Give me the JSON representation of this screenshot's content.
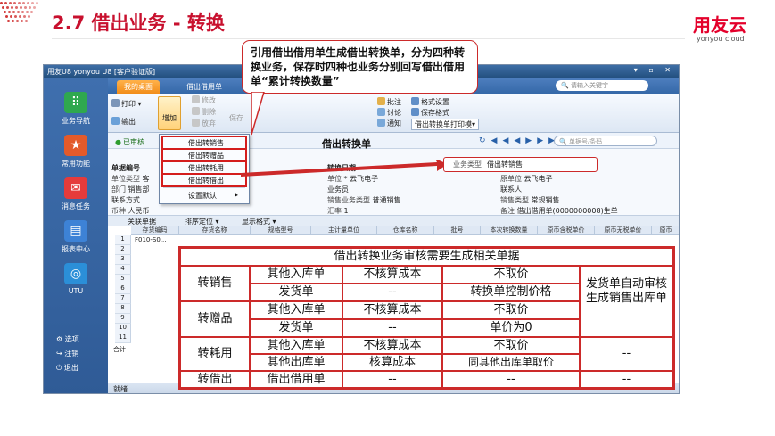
{
  "slide": {
    "title": "2.7 借出业务 - 转换",
    "brand": "用友云",
    "brand_sub": "yonyou cloud"
  },
  "window": {
    "title": "用友U8  yonyou U8 [客户验证版]",
    "controls": "▾ ▫ ✕"
  },
  "sidebar": {
    "items": [
      {
        "label": "业务导航",
        "icon": "nav-icon",
        "color": "#2fa84f"
      },
      {
        "label": "常用功能",
        "icon": "star-icon",
        "color": "#e35a2a"
      },
      {
        "label": "消息任务",
        "icon": "mail-icon",
        "color": "#e53b3b"
      },
      {
        "label": "报表中心",
        "icon": "report-icon",
        "color": "#3d82d6"
      },
      {
        "label": "UTU",
        "icon": "utu-icon",
        "color": "#2b8fd8"
      }
    ],
    "bottom": [
      "选项",
      "注销",
      "退出"
    ]
  },
  "tabs": {
    "items": [
      "我的桌面",
      "借出借用单"
    ],
    "search_placeholder": "请输入关键字"
  },
  "ribbon": {
    "print": "打印",
    "output": "输出",
    "add": "增加",
    "modify": "修改",
    "delete": "删除",
    "discard": "放弃",
    "save": "保存",
    "approve": "批注",
    "discuss": "讨论",
    "notify": "通知",
    "format_settings": "格式设置",
    "save_format": "保存格式",
    "print_template": "借出转换单打印模▾"
  },
  "nav": {
    "status": "已审核",
    "form_title": "借出转换单",
    "search_placeholder": "单据号/条码"
  },
  "form": {
    "doc_no_label": "单据编号",
    "doc_date_label": "转换日期",
    "unit_type_label": "单位类型",
    "unit_type_value": "客",
    "unit_label": "单位",
    "unit_value": "云飞电子",
    "orig_unit_label": "原单位",
    "orig_unit_value": "云飞电子",
    "dept_label": "部门",
    "dept_value": "销售部",
    "salesman_label": "业务员",
    "contact_label": "联系人",
    "contact_method_label": "联系方式",
    "biz_type2_label": "销售业务类型",
    "biz_type2_value": "普通销售",
    "sales_type_label": "销售类型",
    "sales_type_value": "常规销售",
    "currency_label": "币种",
    "currency_value": "人民币",
    "rate_label": "汇率",
    "rate_value": "1",
    "remark_label": "备注",
    "remark_value": "借出借用单(0000000008)生单",
    "biz_type_label": "业务类型",
    "biz_type_value": "借出转销售"
  },
  "table_toolbar": [
    "关联单据",
    "排序定位 ▾",
    "显示格式 ▾"
  ],
  "grid": {
    "headers": [
      "存货编码",
      "存货名称",
      "规格型号",
      "主计量单位",
      "仓库名称",
      "批号",
      "本次转换数量",
      "原币含税单价",
      "原币无税单价",
      "原币"
    ],
    "rows": [
      "1",
      "2",
      "3",
      "4",
      "5",
      "6",
      "7",
      "8",
      "9",
      "10",
      "11"
    ],
    "first_row_code": "F010-S0...",
    "total_label": "合计"
  },
  "status_bar": "就绪",
  "dropdown": {
    "items": [
      "借出转销售",
      "借出转赠品",
      "借出转耗用",
      "借出转借出"
    ],
    "extra": "设置默认",
    "extra_arrow": "▸"
  },
  "callout": {
    "text": "引用借出借用单生成借出转换单，分为四种转换业务，保存时四种也业务分别回写借出借用单“累计转换数量”"
  },
  "overlay": {
    "header": "借出转换业务审核需要生成相关单据",
    "groups": [
      {
        "type": "转销售",
        "rows": [
          [
            "其他入库单",
            "不核算成本",
            "不取价"
          ],
          [
            "发货单",
            "--",
            "转换单控制价格"
          ]
        ]
      },
      {
        "type": "转赠品",
        "rows": [
          [
            "其他入库单",
            "不核算成本",
            "不取价"
          ],
          [
            "发货单",
            "--",
            "单价为0"
          ]
        ]
      },
      {
        "type": "转耗用",
        "rows": [
          [
            "其他入库单",
            "不核算成本",
            "不取价"
          ],
          [
            "其他出库单",
            "核算成本",
            "同其他出库单取价"
          ]
        ]
      },
      {
        "type": "转借出",
        "rows": [
          [
            "借出借用单",
            "--",
            "--"
          ]
        ]
      }
    ],
    "right_col": [
      "发货单自动审核生成销售出库单",
      "--",
      "--"
    ]
  }
}
